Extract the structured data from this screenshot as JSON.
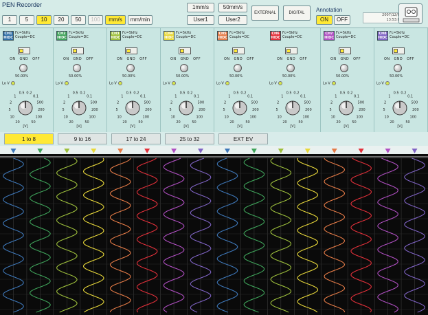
{
  "window": {
    "title": "PEN Recorder"
  },
  "toolbar": {
    "speed_buttons": [
      {
        "label": "1",
        "state": "normal"
      },
      {
        "label": "5",
        "state": "normal"
      },
      {
        "label": "10",
        "state": "selected"
      },
      {
        "label": "20",
        "state": "normal"
      },
      {
        "label": "50",
        "state": "normal"
      },
      {
        "label": "100",
        "state": "disabled"
      }
    ],
    "unit_buttons": [
      {
        "label": "mm/s",
        "state": "selected"
      },
      {
        "label": "mm/min",
        "state": "normal"
      }
    ],
    "preset_rate_labels": [
      "1mm/s",
      "50mm/s"
    ],
    "user_buttons": [
      "User1",
      "User2"
    ],
    "external_label": "EXTERNAL",
    "digital_label": "DIGITAL",
    "annotation_label": "Annotation",
    "annotation_on": "ON",
    "annotation_off": "OFF",
    "datetime_line1": "2007/12/06",
    "datetime_line2": "13:53:00"
  },
  "channels": [
    {
      "id": "CH1",
      "coupling": "HIDC",
      "info1": "Fc=5kHz",
      "info2": "Couple=DC",
      "switch": [
        "ON",
        "GND",
        "OFF"
      ],
      "value": "50.00%",
      "lo_label": "Lo V",
      "color": "#2f6ea6"
    },
    {
      "id": "CH2",
      "coupling": "HIDC",
      "info1": "Fc=5kHz",
      "info2": "Couple=DC",
      "switch": [
        "ON",
        "GND",
        "OFF"
      ],
      "value": "50.00%",
      "lo_label": "Lo V",
      "color": "#3fa35a"
    },
    {
      "id": "CH3",
      "coupling": "HIDC",
      "info1": "Fc=5kHz",
      "info2": "Couple=DC",
      "switch": [
        "ON",
        "GND",
        "OFF"
      ],
      "value": "50.00%",
      "lo_label": "Lo V",
      "color": "#9dbf3c"
    },
    {
      "id": "CH4",
      "coupling": "HIDC",
      "info1": "Fc=5kHz",
      "info2": "Couple=DC",
      "switch": [
        "ON",
        "GND",
        "OFF"
      ],
      "value": "50.00%",
      "lo_label": "Lo V",
      "color": "#e8d83a"
    },
    {
      "id": "CH5",
      "coupling": "HIDC",
      "info1": "Fc=5kHz",
      "info2": "Couple=DC",
      "switch": [
        "ON",
        "GND",
        "OFF"
      ],
      "value": "50.00%",
      "lo_label": "Lo V",
      "color": "#e57b47"
    },
    {
      "id": "CH6",
      "coupling": "HIDC",
      "info1": "Fc=5kHz",
      "info2": "Couple=DC",
      "switch": [
        "ON",
        "GND",
        "OFF"
      ],
      "value": "50.00%",
      "lo_label": "Lo V",
      "color": "#e2303a"
    },
    {
      "id": "CH7",
      "coupling": "HIDC",
      "info1": "Fc=5kHz",
      "info2": "Couple=DC",
      "switch": [
        "ON",
        "GND",
        "OFF"
      ],
      "value": "50.00%",
      "lo_label": "Lo V",
      "color": "#b04fc2"
    },
    {
      "id": "CH8",
      "coupling": "HIDC",
      "info1": "Fc=5kHz",
      "info2": "Couple=DC",
      "switch": [
        "ON",
        "GND",
        "OFF"
      ],
      "value": "50.00%",
      "lo_label": "Lo V",
      "color": "#7f63c4"
    }
  ],
  "dial_scale": {
    "labels": [
      "20",
      "10",
      "5",
      "2",
      "1",
      "0.5",
      "0.2",
      "0.1",
      "500",
      "200",
      "100",
      "50"
    ],
    "unit": "[V]"
  },
  "tabs": [
    {
      "label": "1 to 8",
      "active": true
    },
    {
      "label": "9 to 16",
      "active": false
    },
    {
      "label": "17 to 24",
      "active": false
    },
    {
      "label": "25 to 32",
      "active": false
    },
    {
      "label": "EXT EV",
      "active": false
    }
  ],
  "traces": {
    "count": 16,
    "colors": [
      "#3e77b8",
      "#3fa35a",
      "#9dbf3c",
      "#e8d83a",
      "#e57b47",
      "#e2303a",
      "#b04fc2",
      "#7f63c4",
      "#3e77b8",
      "#3fa35a",
      "#9dbf3c",
      "#e8d83a",
      "#e57b47",
      "#e2303a",
      "#b04fc2",
      "#7f63c4"
    ],
    "cycles": 6.5
  }
}
